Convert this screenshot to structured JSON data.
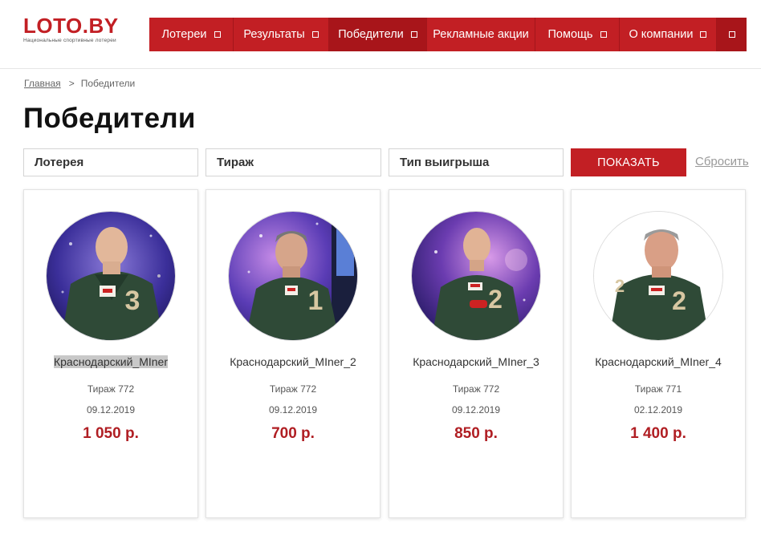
{
  "logo": {
    "title": "LOTO.BY",
    "subtitle": "Национальные спортивные лотереи"
  },
  "nav": {
    "items": [
      {
        "label": "Лотереи"
      },
      {
        "label": "Результаты"
      },
      {
        "label": "Победители"
      },
      {
        "label": "Рекламные акции"
      },
      {
        "label": "Помощь"
      },
      {
        "label": "О компании"
      }
    ]
  },
  "breadcrumb": {
    "home": "Главная",
    "separator": ">",
    "current": "Победители"
  },
  "page": {
    "title": "Победители"
  },
  "filters": {
    "lottery": "Лотерея",
    "draw": "Тираж",
    "prize_type": "Тип выигрыша",
    "show_button": "ПОКАЗАТЬ",
    "reset_link": "Сбросить"
  },
  "winners": [
    {
      "name": "Краснодарский_MIner",
      "draw": "Тираж 772",
      "date": "09.12.2019",
      "prize": "1 050 р.",
      "shirt_number": "3"
    },
    {
      "name": "Краснодарский_MIner_2",
      "draw": "Тираж 772",
      "date": "09.12.2019",
      "prize": "700 р.",
      "shirt_number": "1"
    },
    {
      "name": "Краснодарский_MIner_3",
      "draw": "Тираж 772",
      "date": "09.12.2019",
      "prize": "850 р.",
      "shirt_number": "2"
    },
    {
      "name": "Краснодарский_MIner_4",
      "draw": "Тираж 771",
      "date": "02.12.2019",
      "prize": "1 400 р.",
      "shirt_number": "2"
    }
  ],
  "colors": {
    "brand_red": "#c21f24",
    "prize_red": "#b01e23",
    "robe_green": "#2f4a37"
  }
}
